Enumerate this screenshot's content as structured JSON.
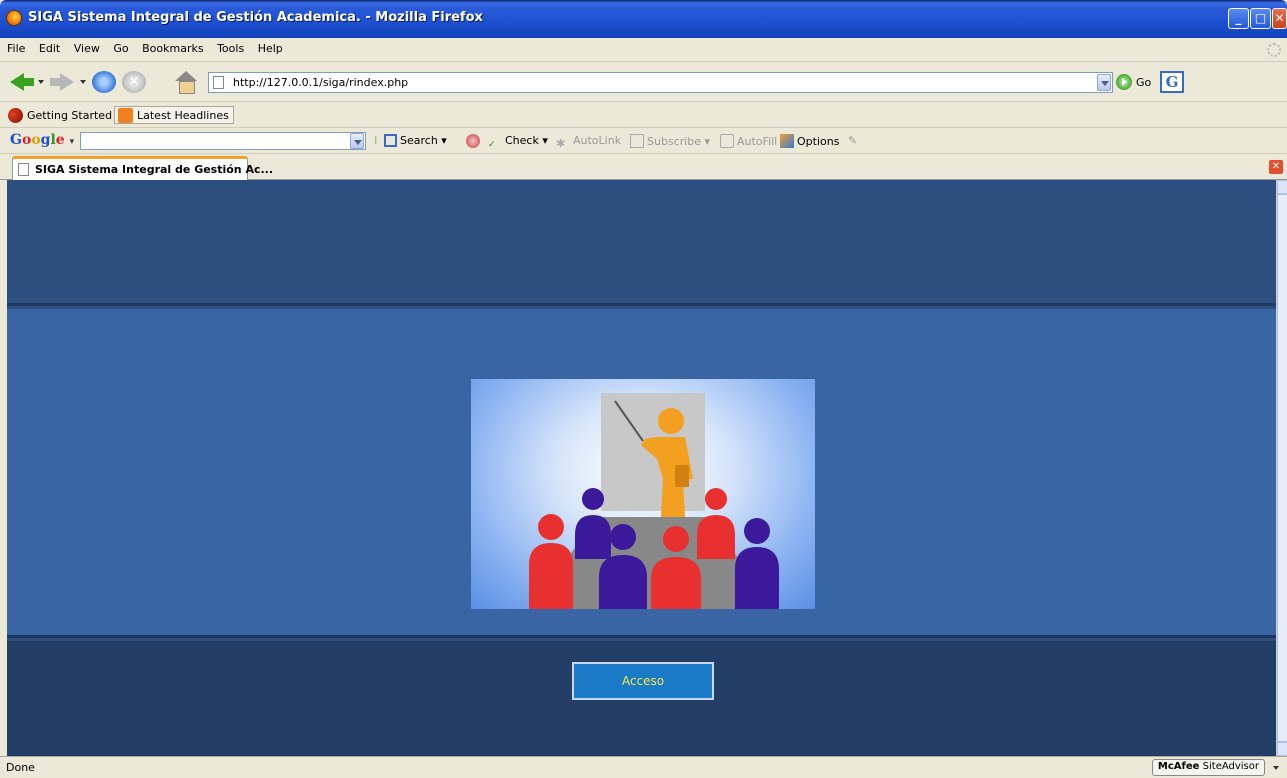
{
  "window": {
    "title": "SIGA Sistema Integral de Gestión Academica. - Mozilla Firefox",
    "controls": {
      "minimize": "_",
      "maximize": "□",
      "close": "✕"
    }
  },
  "menu": [
    "File",
    "Edit",
    "View",
    "Go",
    "Bookmarks",
    "Tools",
    "Help"
  ],
  "navigation": {
    "url": "http://127.0.0.1/siga/rindex.php",
    "go_label": "Go",
    "search_engine_glyph": "G"
  },
  "bookmarks": [
    "Getting Started",
    "Latest Headlines"
  ],
  "google_toolbar": {
    "logo": [
      "G",
      "o",
      "o",
      "g",
      "l",
      "e"
    ],
    "tools": {
      "search": "Search",
      "check": "Check",
      "autolink": "AutoLink",
      "subscribe": "Subscribe",
      "autofill": "AutoFill",
      "options": "Options"
    }
  },
  "tabs": [
    {
      "label": "SIGA Sistema Integral de Gestión Ac...",
      "active": true
    }
  ],
  "page": {
    "button_label": "Acceso",
    "colors": {
      "header": "#2c4f80",
      "middle": "#3a65a5",
      "footer": "#233e66",
      "button": "#1a7ac8",
      "button_text": "#f6e84a"
    }
  },
  "statusbar": {
    "status": "Done",
    "addon_brand": "McAfee",
    "addon_name": "SiteAdvisor"
  }
}
